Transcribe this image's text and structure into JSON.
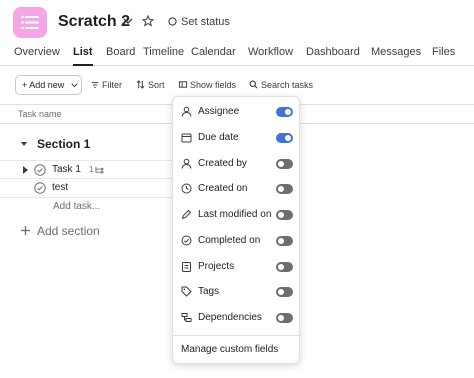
{
  "project": {
    "title": "Scratch 2",
    "set_status": "Set status"
  },
  "tabs": [
    "Overview",
    "List",
    "Board",
    "Timeline",
    "Calendar",
    "Workflow",
    "Dashboard",
    "Messages",
    "Files"
  ],
  "toolbar": {
    "add_new": "+ Add new",
    "filter": "Filter",
    "sort": "Sort",
    "show_fields": "Show fields",
    "search_tasks": "Search tasks"
  },
  "table": {
    "column_header": "Task name",
    "section_title": "Section 1",
    "tasks": [
      {
        "name": "Task 1",
        "subtask_count": "1"
      },
      {
        "name": "test"
      }
    ],
    "add_task": "Add task...",
    "add_section": "Add section"
  },
  "fields_menu": {
    "items": [
      {
        "label": "Assignee",
        "icon": "person-icon",
        "on": true
      },
      {
        "label": "Due date",
        "icon": "calendar-icon",
        "on": true
      },
      {
        "label": "Created by",
        "icon": "person-icon",
        "on": false
      },
      {
        "label": "Created on",
        "icon": "clock-icon",
        "on": false
      },
      {
        "label": "Last modified on",
        "icon": "pencil-icon",
        "on": false
      },
      {
        "label": "Completed on",
        "icon": "check-circle-icon",
        "on": false
      },
      {
        "label": "Projects",
        "icon": "clipboard-icon",
        "on": false
      },
      {
        "label": "Tags",
        "icon": "tag-icon",
        "on": false
      },
      {
        "label": "Dependencies",
        "icon": "dependencies-icon",
        "on": false
      }
    ],
    "manage_label": "Manage custom fields"
  },
  "colors": {
    "toggle_on": "#4573d2",
    "toggle_off": "#6d6e6f",
    "logo": "#f4a6e6"
  }
}
